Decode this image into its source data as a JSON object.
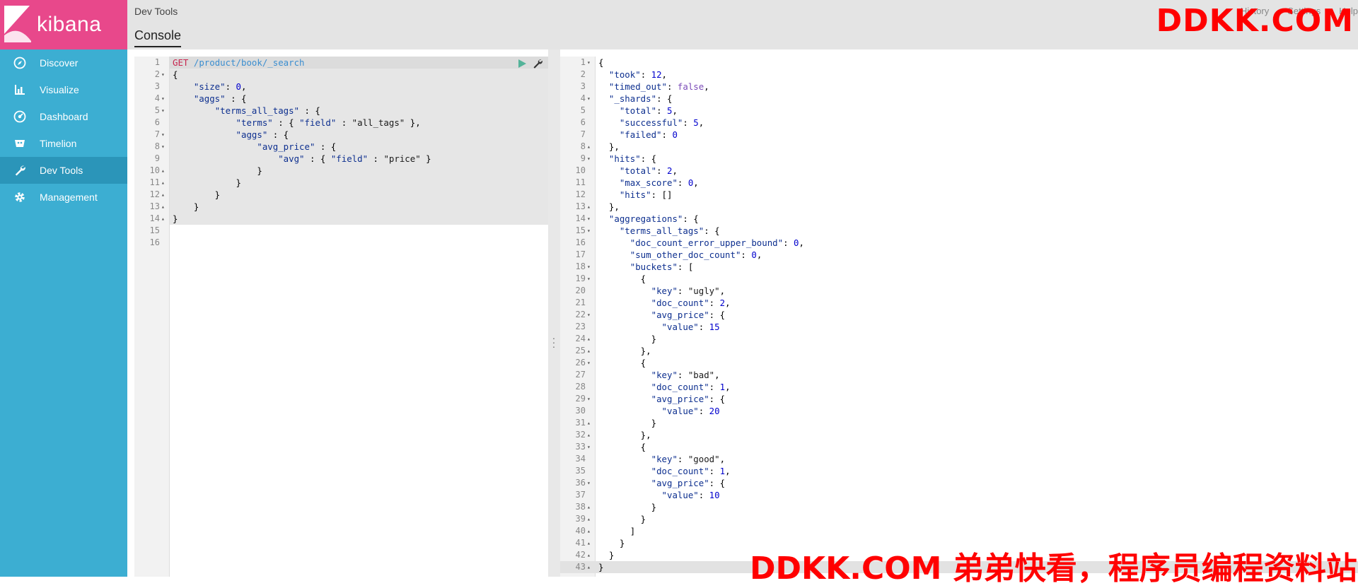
{
  "app": {
    "name": "kibana"
  },
  "sidebar": {
    "items": [
      {
        "label": "Discover",
        "icon": "compass-icon"
      },
      {
        "label": "Visualize",
        "icon": "bar-chart-icon"
      },
      {
        "label": "Dashboard",
        "icon": "dashboard-icon"
      },
      {
        "label": "Timelion",
        "icon": "timelion-icon"
      },
      {
        "label": "Dev Tools",
        "icon": "wrench-icon",
        "active": true
      },
      {
        "label": "Management",
        "icon": "gear-icon"
      }
    ]
  },
  "header": {
    "breadcrumb": "Dev Tools",
    "tab": "Console",
    "links": [
      "History",
      "Settings",
      "Help"
    ]
  },
  "watermark": {
    "top": "DDKK.COM",
    "bottom": "DDKK.COM 弟弟快看，程序员编程资料站"
  },
  "colors": {
    "sidebar": "#3caed2",
    "logo": "#e8488b",
    "active": "#2b95b9"
  },
  "request": {
    "lines": [
      "GET /product/book/_search",
      "{",
      "    \"size\": 0,",
      "    \"aggs\" : {",
      "        \"terms_all_tags\" : {",
      "            \"terms\" : { \"field\" : \"all_tags\" },",
      "            \"aggs\" : {",
      "                \"avg_price\" : {",
      "                    \"avg\" : { \"field\" : \"price\" }",
      "                }",
      "            }",
      "        }",
      "    }",
      "}",
      "",
      ""
    ],
    "line_numbers": [
      "1",
      "2",
      "3",
      "4",
      "5",
      "6",
      "7",
      "8",
      "9",
      "10",
      "11",
      "12",
      "13",
      "14",
      "15",
      "16"
    ]
  },
  "response": {
    "lines": [
      "{",
      "  \"took\": 12,",
      "  \"timed_out\": false,",
      "  \"_shards\": {",
      "    \"total\": 5,",
      "    \"successful\": 5,",
      "    \"failed\": 0",
      "  },",
      "  \"hits\": {",
      "    \"total\": 2,",
      "    \"max_score\": 0,",
      "    \"hits\": []",
      "  },",
      "  \"aggregations\": {",
      "    \"terms_all_tags\": {",
      "      \"doc_count_error_upper_bound\": 0,",
      "      \"sum_other_doc_count\": 0,",
      "      \"buckets\": [",
      "        {",
      "          \"key\": \"ugly\",",
      "          \"doc_count\": 2,",
      "          \"avg_price\": {",
      "            \"value\": 15",
      "          }",
      "        },",
      "        {",
      "          \"key\": \"bad\",",
      "          \"doc_count\": 1,",
      "          \"avg_price\": {",
      "            \"value\": 20",
      "          }",
      "        },",
      "        {",
      "          \"key\": \"good\",",
      "          \"doc_count\": 1,",
      "          \"avg_price\": {",
      "            \"value\": 10",
      "          }",
      "        }",
      "      ]",
      "    }",
      "  }",
      "}"
    ]
  }
}
